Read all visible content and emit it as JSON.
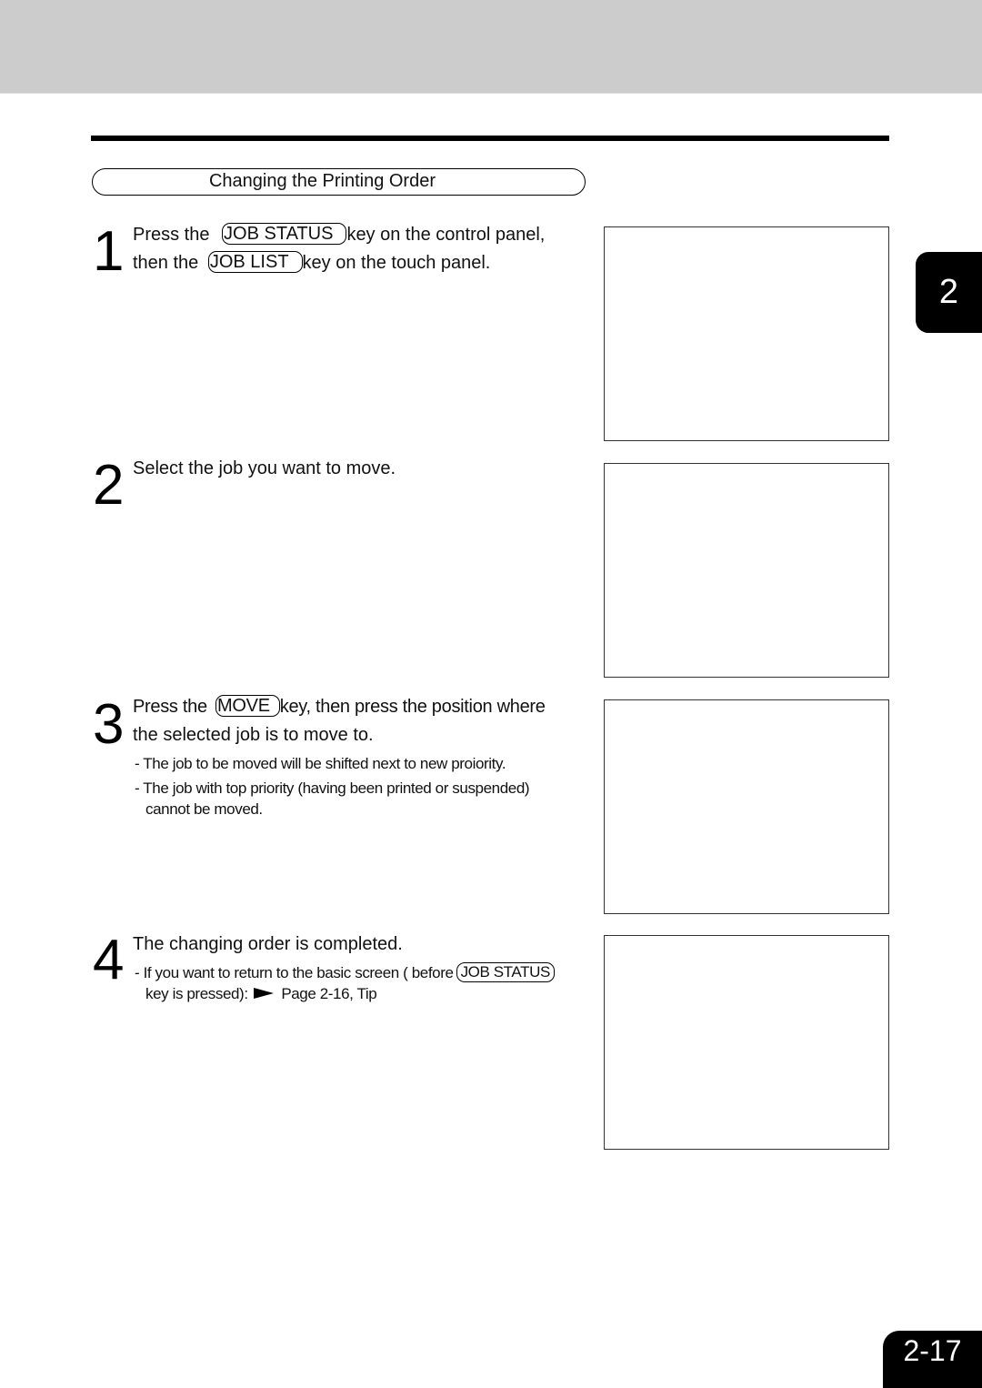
{
  "header": {
    "band_color": "#cccccc"
  },
  "section": {
    "title": "Changing the Printing Order"
  },
  "steps": [
    {
      "number": "1",
      "lines": [
        {
          "before": "Press the ",
          "key": "JOB STATUS",
          "after": "key on the control panel,"
        },
        {
          "before": "then the ",
          "key": "JOB LIST",
          "after": "key on the touch panel."
        }
      ]
    },
    {
      "number": "2",
      "text": "Select the job you want to move."
    },
    {
      "number": "3",
      "lines": [
        {
          "before": "Press the ",
          "key": "MOVE",
          "after": "key, then press the position where"
        },
        {
          "text": "the selected job is to move to."
        }
      ],
      "notes": [
        "- The job to be moved will be shifted next to new proiority.",
        "- The job with top priority (having been printed or suspended)",
        "cannot be moved."
      ]
    },
    {
      "number": "4",
      "text": "The changing order is completed.",
      "note": {
        "before": "- If you want to return to the basic screen ( before",
        "key": "JOB  STATUS",
        "line2_before": "key is pressed):",
        "arrow_icon": "right-pointer-icon",
        "reference": "Page 2-16, Tip"
      }
    }
  ],
  "chapter_tab": "2",
  "page_number": "2-17"
}
